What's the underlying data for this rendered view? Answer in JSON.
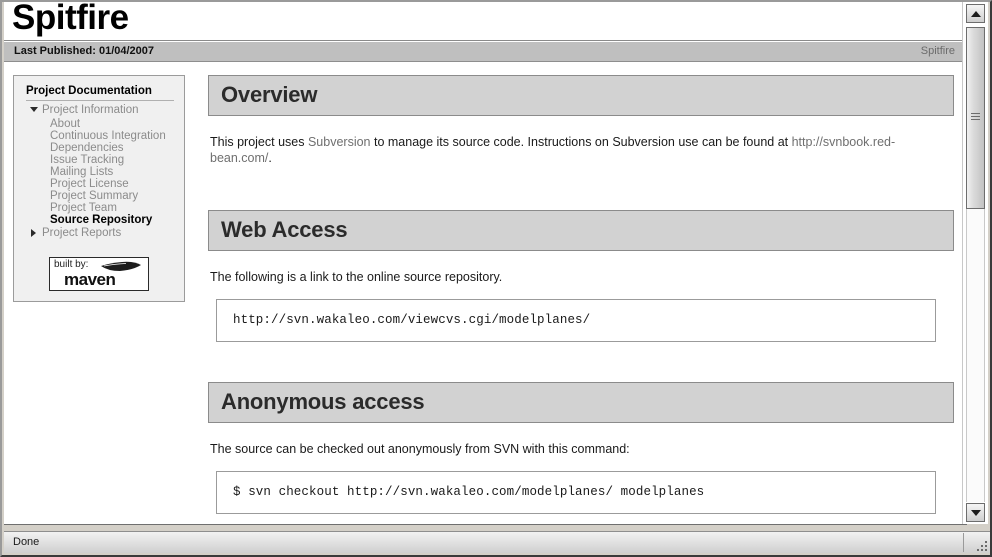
{
  "window": {
    "status_text": "Done"
  },
  "banner": {
    "title": "Spitfire"
  },
  "breadcrumb": {
    "published_label": "Last Published: 01/04/2007",
    "project_name": "Spitfire"
  },
  "sidebar": {
    "heading": "Project Documentation",
    "sections": [
      {
        "label": "Project Information",
        "expanded": true,
        "marker": "triangle-down-icon",
        "items": [
          {
            "label": "About",
            "active": false
          },
          {
            "label": "Continuous Integration",
            "active": false
          },
          {
            "label": "Dependencies",
            "active": false
          },
          {
            "label": "Issue Tracking",
            "active": false
          },
          {
            "label": "Mailing Lists",
            "active": false
          },
          {
            "label": "Project License",
            "active": false
          },
          {
            "label": "Project Summary",
            "active": false
          },
          {
            "label": "Project Team",
            "active": false
          },
          {
            "label": "Source Repository",
            "active": true
          }
        ]
      },
      {
        "label": "Project Reports",
        "expanded": false,
        "marker": "triangle-right-icon",
        "items": []
      }
    ],
    "logo": {
      "built_by": "built by:",
      "name": "maven"
    }
  },
  "content": {
    "sections": [
      {
        "title": "Overview",
        "paragraph_prefix": "This project uses ",
        "paragraph_link": "Subversion",
        "paragraph_middle": " to manage its source code. Instructions on Subversion use can be found at ",
        "paragraph_link2": "http://svnbook.red-bean.com/",
        "paragraph_suffix": "."
      },
      {
        "title": "Web Access",
        "paragraph": "The following is a link to the online source repository.",
        "code": "http://svn.wakaleo.com/viewcvs.cgi/modelplanes/"
      },
      {
        "title": "Anonymous access",
        "paragraph": "The source can be checked out anonymously from SVN with this command:",
        "code": "$ svn checkout http://svn.wakaleo.com/modelplanes/ modelplanes"
      }
    ]
  },
  "colors": {
    "section_header_bg": "#d2d2d2",
    "breadcrumb_bg": "#bfbfbf",
    "sidebar_bg": "#f0f0f0",
    "link": "#6f6f6f",
    "body_text": "#1a1a1a",
    "inactive_nav": "#8b8b8b"
  }
}
